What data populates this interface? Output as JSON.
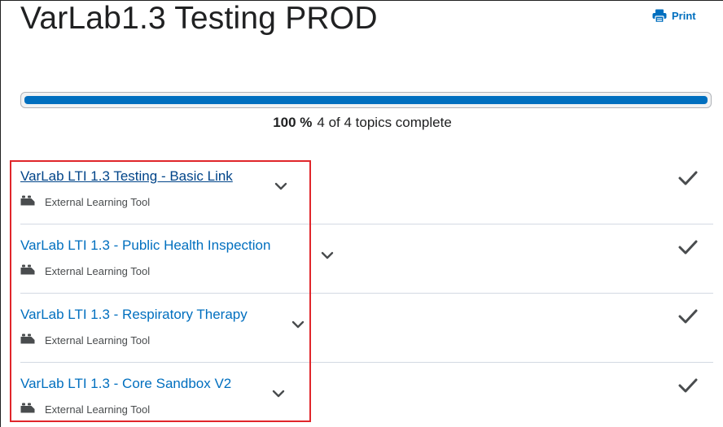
{
  "page": {
    "title": "VarLab1.3 Testing PROD"
  },
  "print": {
    "label": "Print",
    "icon": "printer-icon",
    "color": "#006fbf"
  },
  "progress": {
    "percent_label": "100 %",
    "summary": "4 of 4 topics complete",
    "value": 1.0,
    "fill_color": "#006fbf"
  },
  "topics": [
    {
      "title": "VarLab LTI 1.3 Testing - Basic Link",
      "type": "External Learning Tool",
      "completed": true,
      "visited": true
    },
    {
      "title": "VarLab LTI 1.3 - Public Health Inspection",
      "type": "External Learning Tool",
      "completed": true,
      "visited": false
    },
    {
      "title": "VarLab LTI 1.3 - Respiratory Therapy",
      "type": "External Learning Tool",
      "completed": true,
      "visited": false
    },
    {
      "title": "VarLab LTI 1.3 - Core Sandbox V2",
      "type": "External Learning Tool",
      "completed": true,
      "visited": false
    }
  ],
  "highlight_color": "#e0262b"
}
